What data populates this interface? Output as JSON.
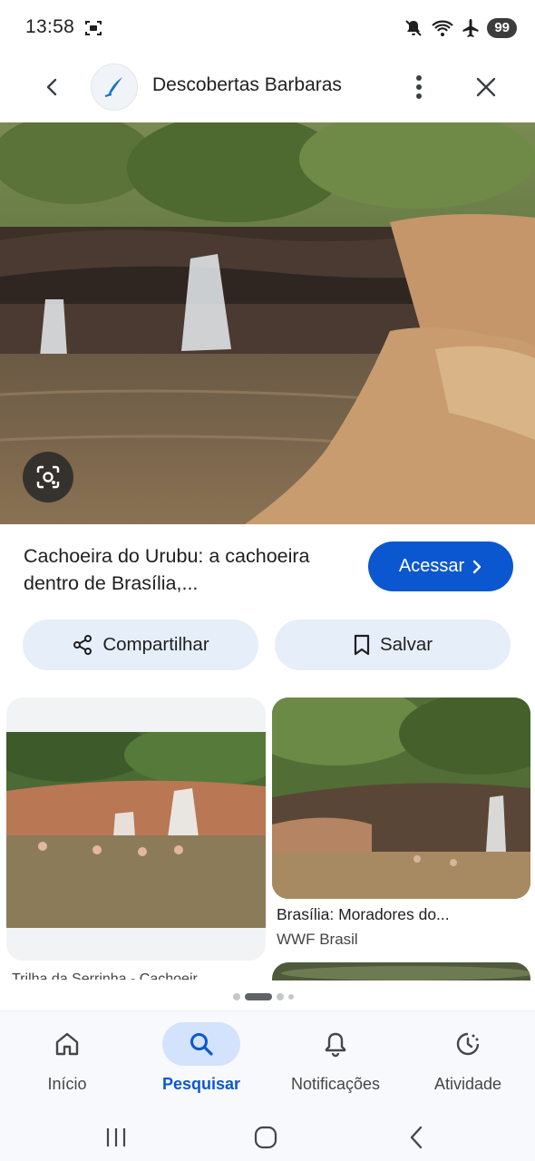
{
  "status_bar": {
    "time": "13:58",
    "battery": "99",
    "icons": [
      "screenshot-icon",
      "mute-icon",
      "wifi-icon",
      "airplane-icon",
      "battery-icon"
    ]
  },
  "app_bar": {
    "site_name": "Descobertas Barbaras",
    "icons": [
      "back-arrow-icon",
      "site-logo-icon",
      "more-vert-icon",
      "close-icon"
    ]
  },
  "result": {
    "title": "Cachoeira do Urubu: a cachoeira dentro de Brasília,...",
    "visit_label": "Acessar",
    "share_label": "Compartilhar",
    "save_label": "Salvar"
  },
  "related": [
    {
      "caption": "Trilha da Serrinha - Cachoeir",
      "source": ""
    },
    {
      "caption": "Brasília: Moradores do...",
      "source": "WWF Brasil"
    }
  ],
  "bottom_nav": [
    {
      "label": "Início",
      "icon": "home-icon",
      "active": false
    },
    {
      "label": "Pesquisar",
      "icon": "search-icon",
      "active": true
    },
    {
      "label": "Notificações",
      "icon": "bell-icon",
      "active": false
    },
    {
      "label": "Atividade",
      "icon": "activity-icon",
      "active": false
    }
  ],
  "colors": {
    "accent": "#0b57d0",
    "button_bg": "#e6eef9",
    "active_pill": "#d3e3fd"
  }
}
